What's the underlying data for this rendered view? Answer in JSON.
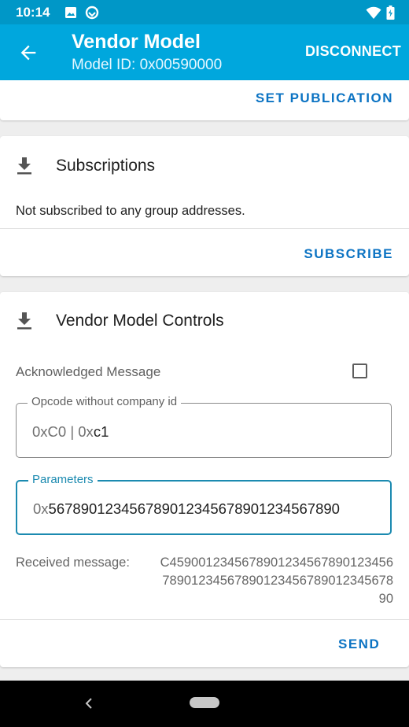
{
  "status_bar": {
    "time": "10:14",
    "icons": [
      "image-icon",
      "sync-icon",
      "wifi-icon",
      "battery-icon"
    ]
  },
  "app_bar": {
    "title": "Vendor Model",
    "subtitle": "Model ID: 0x00590000",
    "action": "DISCONNECT"
  },
  "publication": {
    "action": "SET PUBLICATION"
  },
  "subscriptions": {
    "title": "Subscriptions",
    "message": "Not subscribed to any group addresses.",
    "action": "SUBSCRIBE"
  },
  "controls": {
    "title": "Vendor Model Controls",
    "ack_label": "Acknowledged Message",
    "ack_checked": false,
    "opcode": {
      "label": "Opcode without company id",
      "prefix": "0xC0 | 0x",
      "value": "c1"
    },
    "parameters": {
      "label": "Parameters",
      "prefix": "0x",
      "value": "567890123456789012345678901234567890"
    },
    "received_label": "Received message:",
    "received_line1": "C4590012345678901234567890123456",
    "received_line2": "78901234567890123456789012345678",
    "received_line3": "90",
    "send": "SEND"
  },
  "colors": {
    "status_bar": "#0097c7",
    "app_bar": "#00a7dd",
    "accent": "#0b73c3",
    "focus": "#1b8ab0"
  }
}
